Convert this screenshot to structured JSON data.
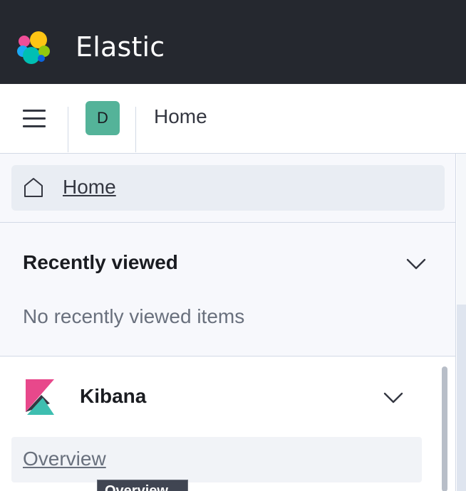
{
  "topbar": {
    "brand": "Elastic",
    "logo_icon": "elastic-logo-icon",
    "colors": {
      "background": "#25282f",
      "text": "#ffffff"
    }
  },
  "header": {
    "menu_icon": "hamburger-menu-icon",
    "space_initial": "D",
    "space_color": "#54b399",
    "breadcrumb": "Home"
  },
  "nav": {
    "home": {
      "label": "Home",
      "icon": "home-icon"
    },
    "recently_viewed": {
      "title": "Recently viewed",
      "empty_text": "No recently viewed items",
      "icon": "chevron-down-icon"
    },
    "kibana": {
      "title": "Kibana",
      "icon": "kibana-logo-icon",
      "items": [
        {
          "label": "Overview"
        }
      ]
    }
  },
  "tooltip": {
    "text": "Overview"
  },
  "colors": {
    "accent_pink": "#e8488b",
    "accent_teal": "#3ebeb0",
    "dark": "#343741"
  }
}
